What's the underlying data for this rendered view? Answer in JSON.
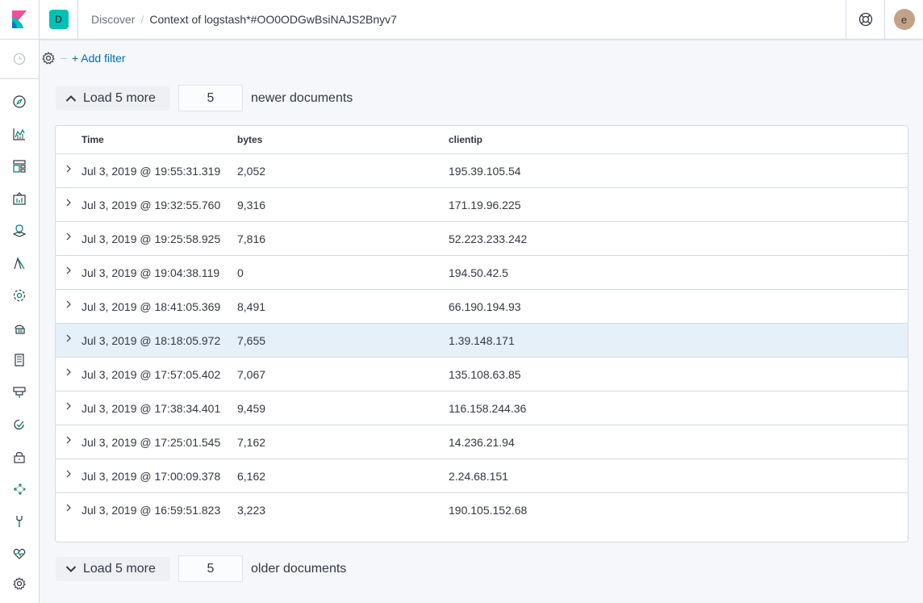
{
  "header": {
    "space_initial": "D",
    "breadcrumbs": [
      "Discover",
      "Context of logstash*#OO0ODGwBsiNAJS2Bnyv7"
    ],
    "user_initial": "e"
  },
  "sidenav": {
    "icons": [
      "clock-icon",
      "discover-icon",
      "visualize-icon",
      "dashboard-icon",
      "canvas-icon",
      "maps-icon",
      "ml-icon",
      "infrastructure-icon",
      "logs-icon",
      "apm-icon",
      "uptime-icon",
      "siem-icon",
      "graph-icon",
      "security-icon",
      "dev-tools-icon",
      "monitoring-icon",
      "management-icon"
    ]
  },
  "filterbar": {
    "add_filter": "+ Add filter"
  },
  "load_newer": {
    "button": "Load 5 more",
    "count": "5",
    "suffix": "newer documents"
  },
  "load_older": {
    "button": "Load 5 more",
    "count": "5",
    "suffix": "older documents"
  },
  "table": {
    "columns": [
      "Time",
      "bytes",
      "clientip"
    ],
    "rows": [
      {
        "time": "Jul 3, 2019 @ 19:55:31.319",
        "bytes": "2,052",
        "clientip": "195.39.105.54"
      },
      {
        "time": "Jul 3, 2019 @ 19:32:55.760",
        "bytes": "9,316",
        "clientip": "171.19.96.225"
      },
      {
        "time": "Jul 3, 2019 @ 19:25:58.925",
        "bytes": "7,816",
        "clientip": "52.223.233.242"
      },
      {
        "time": "Jul 3, 2019 @ 19:04:38.119",
        "bytes": "0",
        "clientip": "194.50.42.5"
      },
      {
        "time": "Jul 3, 2019 @ 18:41:05.369",
        "bytes": "8,491",
        "clientip": "66.190.194.93"
      },
      {
        "time": "Jul 3, 2019 @ 18:18:05.972",
        "bytes": "7,655",
        "clientip": "1.39.148.171"
      },
      {
        "time": "Jul 3, 2019 @ 17:57:05.402",
        "bytes": "7,067",
        "clientip": "135.108.63.85"
      },
      {
        "time": "Jul 3, 2019 @ 17:38:34.401",
        "bytes": "9,459",
        "clientip": "116.158.244.36"
      },
      {
        "time": "Jul 3, 2019 @ 17:25:01.545",
        "bytes": "7,162",
        "clientip": "14.236.21.94"
      },
      {
        "time": "Jul 3, 2019 @ 17:00:09.378",
        "bytes": "6,162",
        "clientip": "2.24.68.151"
      },
      {
        "time": "Jul 3, 2019 @ 16:59:51.823",
        "bytes": "3,223",
        "clientip": "190.105.152.68"
      }
    ]
  },
  "colors": {
    "accent": "#006bb4",
    "space_avatar": "#00bfb3",
    "user_avatar": "#c3a287",
    "selected_row": "#e6f0f8"
  }
}
